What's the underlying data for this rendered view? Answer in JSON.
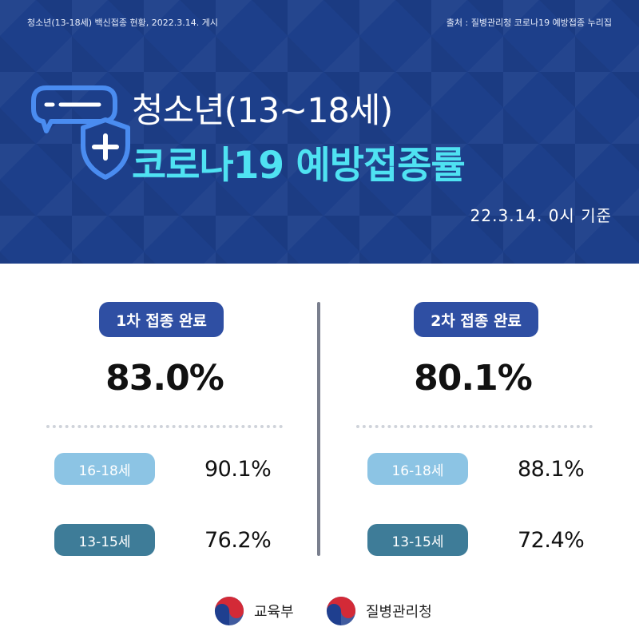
{
  "header": {
    "caption_left": "청소년(13-18세) 백신접종 현황, 2022.3.14. 게시",
    "caption_right": "출처 : 질병관리청 코로나19 예방접종 누리집",
    "title_line1": "청소년(13~18세)",
    "title_line2": "코로나19 예방접종률",
    "basis": "22.3.14. 0시 기준",
    "icon": "chat-shield-icon",
    "colors": {
      "background": "#1d3f8a",
      "accent": "#4fe2f2"
    }
  },
  "first_dose": {
    "label": "1차 접종 완료",
    "total": "83.0%",
    "groups": [
      {
        "label": "16-18세",
        "value": "90.1%"
      },
      {
        "label": "13-15세",
        "value": "76.2%"
      }
    ]
  },
  "second_dose": {
    "label": "2차 접종 완료",
    "total": "80.1%",
    "groups": [
      {
        "label": "16-18세",
        "value": "88.1%"
      },
      {
        "label": "13-15세",
        "value": "72.4%"
      }
    ]
  },
  "footer": {
    "orgs": [
      {
        "name": "교육부",
        "icon": "taegeuk-emblem-icon"
      },
      {
        "name": "질병관리청",
        "icon": "taegeuk-emblem-icon"
      }
    ]
  }
}
